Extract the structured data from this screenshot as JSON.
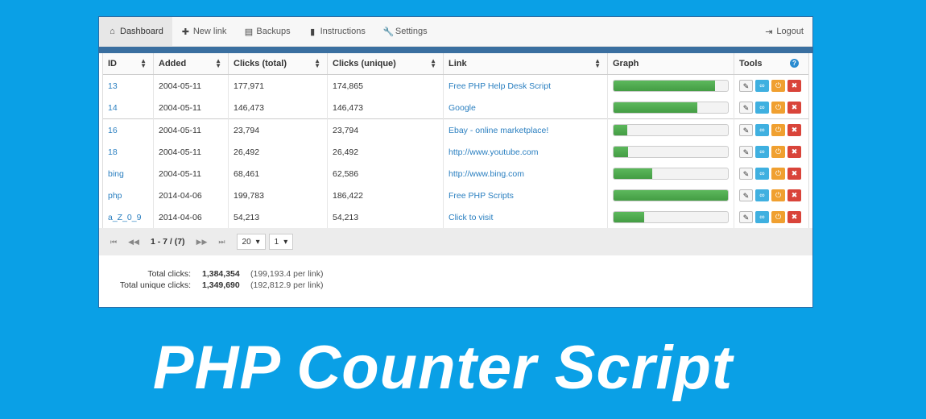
{
  "nav": {
    "items": [
      {
        "label": "Dashboard",
        "icon": "home-icon",
        "glyph": "⌂"
      },
      {
        "label": "New link",
        "icon": "plus-icon",
        "glyph": "✚"
      },
      {
        "label": "Backups",
        "icon": "floppy-icon",
        "glyph": "▤"
      },
      {
        "label": "Instructions",
        "icon": "book-icon",
        "glyph": "▮"
      },
      {
        "label": "Settings",
        "icon": "wrench-icon",
        "glyph": "🔧"
      }
    ],
    "logout": {
      "label": "Logout",
      "icon": "logout-icon",
      "glyph": "⇥"
    }
  },
  "table": {
    "columns": [
      "ID",
      "Added",
      "Clicks (total)",
      "Clicks (unique)",
      "Link",
      "Graph",
      "Tools"
    ],
    "rows": [
      {
        "id": "13",
        "added": "2004-05-11",
        "total": "177,971",
        "unique": "174,865",
        "link": "Free PHP Help Desk Script",
        "graph": 0.89
      },
      {
        "id": "14",
        "added": "2004-05-11",
        "total": "146,473",
        "unique": "146,473",
        "link": "Google",
        "graph": 0.73
      },
      {
        "id": "16",
        "added": "2004-05-11",
        "total": "23,794",
        "unique": "23,794",
        "link": "Ebay - online marketplace!",
        "graph": 0.12
      },
      {
        "id": "18",
        "added": "2004-05-11",
        "total": "26,492",
        "unique": "26,492",
        "link": "http://www.youtube.com",
        "graph": 0.13
      },
      {
        "id": "bing",
        "added": "2004-05-11",
        "total": "68,461",
        "unique": "62,586",
        "link": "http://www.bing.com",
        "graph": 0.34
      },
      {
        "id": "php",
        "added": "2014-04-06",
        "total": "199,783",
        "unique": "186,422",
        "link": "Free PHP Scripts",
        "graph": 1.0
      },
      {
        "id": "a_Z_0_9",
        "added": "2014-04-06",
        "total": "54,213",
        "unique": "54,213",
        "link": "Click to visit",
        "graph": 0.27
      }
    ],
    "tools": [
      {
        "icon": "pencil-icon",
        "glyph": "✎"
      },
      {
        "icon": "chain-link-icon",
        "glyph": "∞"
      },
      {
        "icon": "power-icon",
        "glyph": "⏻"
      },
      {
        "icon": "delete-icon",
        "glyph": "✖"
      }
    ]
  },
  "pager": {
    "first": "⏮",
    "prev": "◀◀",
    "next": "▶▶",
    "last": "⏭",
    "info": "1 - 7 / (7)",
    "page_size": "20",
    "page": "1"
  },
  "totals": {
    "total_label": "Total clicks:",
    "total_value": "1,384,354",
    "total_per": "(199,193.4 per link)",
    "unique_label": "Total unique clicks:",
    "unique_value": "1,349,690",
    "unique_per": "(192,812.9 per link)"
  },
  "headline": "PHP Counter Script"
}
